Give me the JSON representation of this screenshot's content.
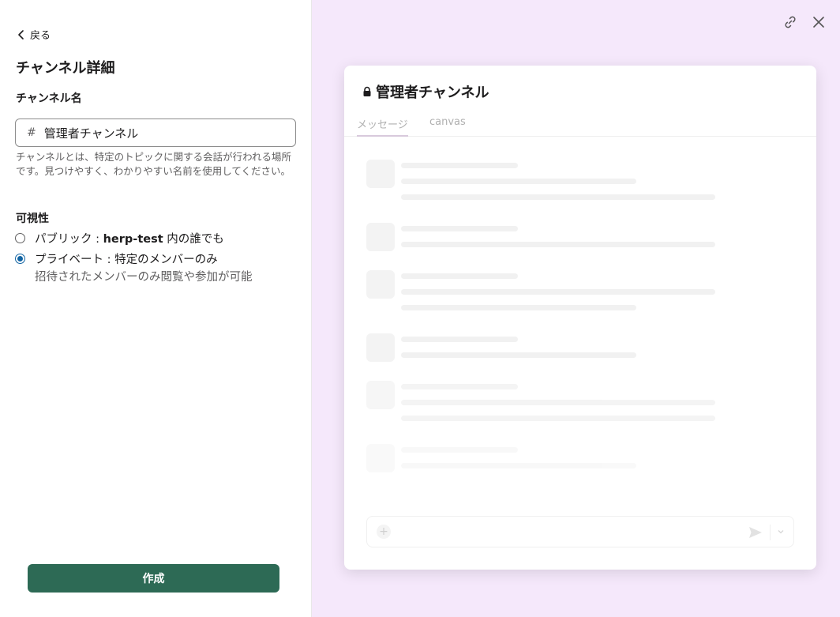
{
  "back": {
    "label": "戻る"
  },
  "page_title": "チャンネル詳細",
  "channel_name": {
    "label": "チャンネル名",
    "prefix": "#",
    "value": "管理者チャンネル",
    "help": "チャンネルとは、特定のトピックに関する会話が行われる場所です。見つけやすく、わかりやすい名前を使用してください。"
  },
  "visibility": {
    "label": "可視性",
    "public": {
      "prefix": "パブリック : ",
      "workspace": "herp-test",
      "suffix": " 内の誰でも",
      "selected": false
    },
    "private": {
      "label": "プライベート : 特定のメンバーのみ",
      "description": "招待されたメンバーのみ閲覧や参加が可能",
      "selected": true
    }
  },
  "create_button": "作成",
  "preview": {
    "channel_title": "管理者チャンネル",
    "tabs": [
      "メッセージ",
      "canvas"
    ],
    "active_tab": "メッセージ"
  },
  "colors": {
    "primary_button": "#2d6a55",
    "preview_background": "#f5e8fb",
    "radio_selected": "#1264a3"
  }
}
